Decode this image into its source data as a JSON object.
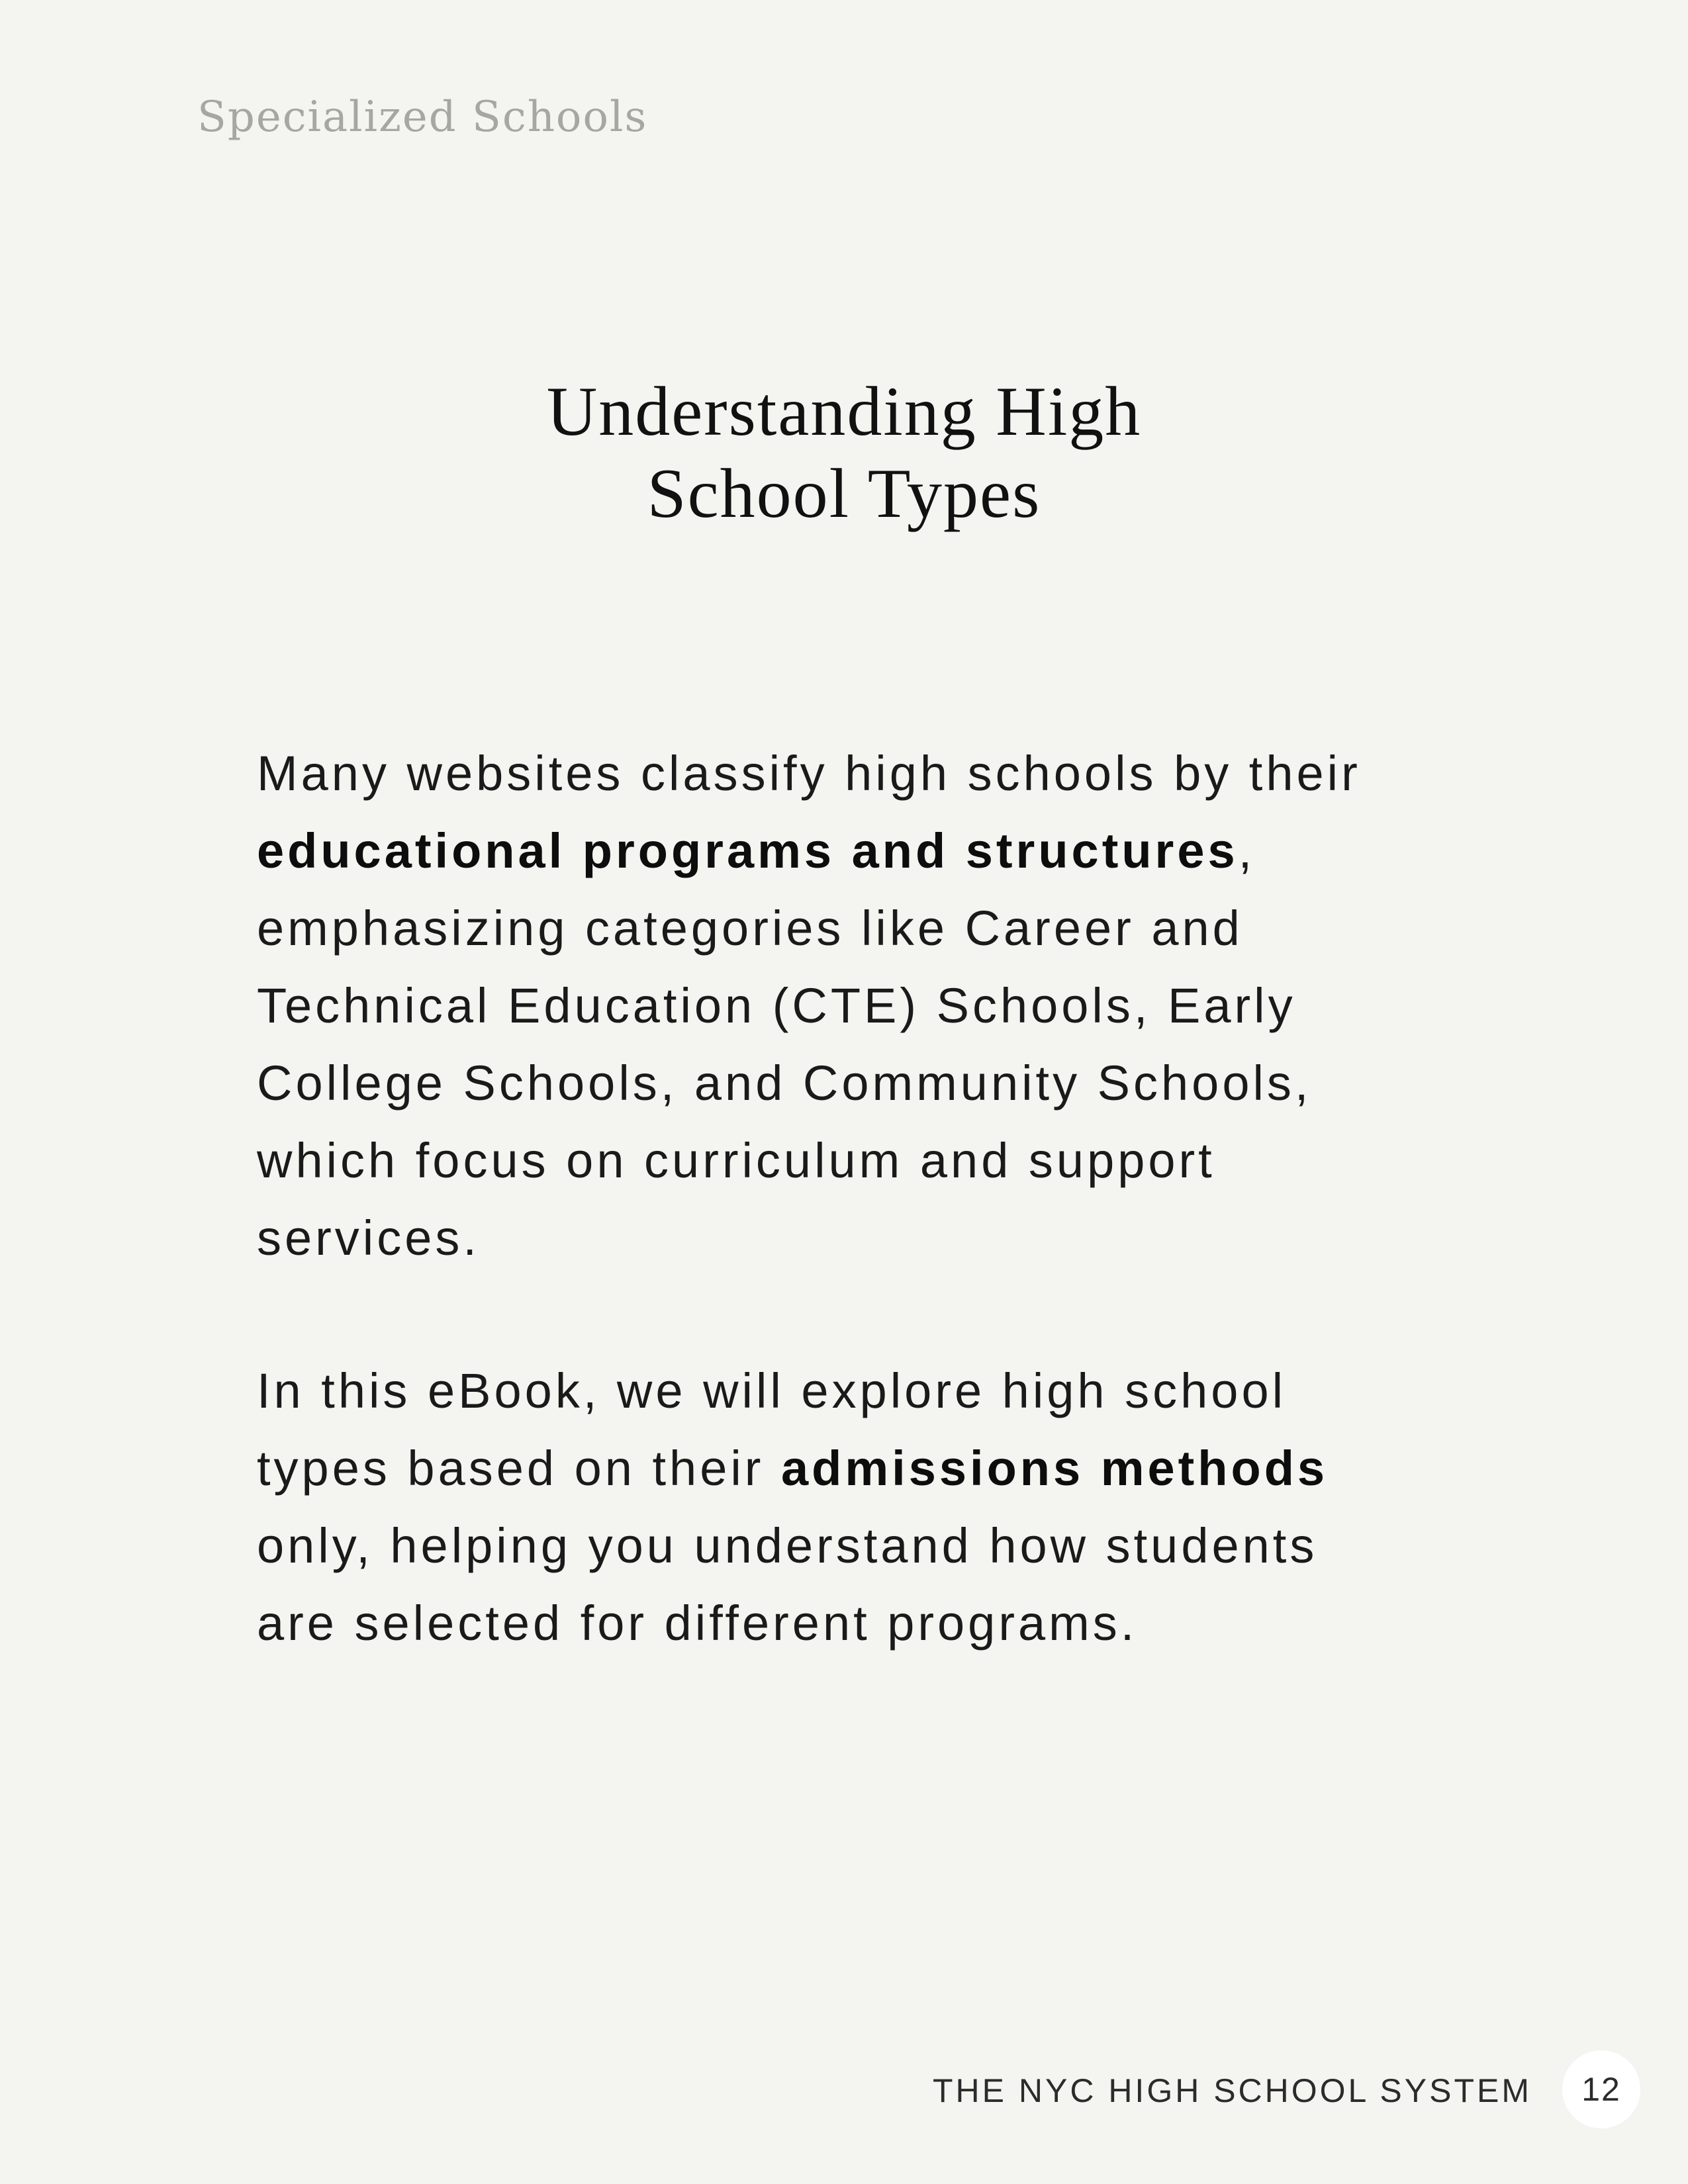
{
  "header": {
    "section_label": "Specialized Schools"
  },
  "title": {
    "line1": "Understanding High",
    "line2": "School Types"
  },
  "paragraph1": {
    "line1": "Many websites classify high schools by their",
    "line2_bold": "educational programs and structures",
    "line2_rest": ",",
    "line3": "emphasizing categories like Career and",
    "line4": "Technical Education (CTE) Schools, Early",
    "line5": "College Schools, and Community Schools,",
    "line6": "which focus on curriculum and support",
    "line7": "services."
  },
  "paragraph2": {
    "line1": "In this eBook, we will explore high school",
    "line2_pre": "types based on their ",
    "line2_bold": "admissions methods",
    "line3": "only, helping you understand how students",
    "line4": "are selected for different programs."
  },
  "footer": {
    "book_title": "THE NYC HIGH SCHOOL SYSTEM",
    "page_number": "12"
  }
}
